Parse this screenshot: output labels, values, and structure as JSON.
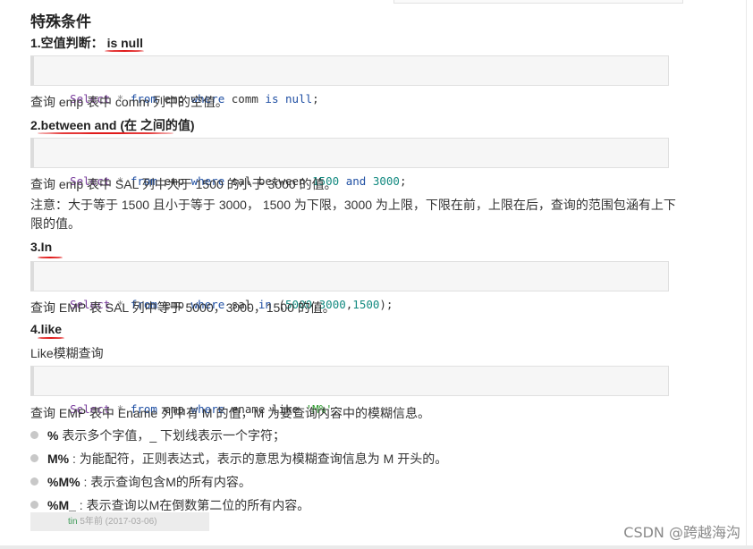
{
  "title": "特殊条件",
  "sections": [
    {
      "heading": "1.空值判断： is null",
      "code": [
        "Select",
        "*",
        "from",
        "emp",
        "where",
        "comm",
        "is",
        "null",
        ";"
      ],
      "desc": "查询 emp 表中 comm 列中的空值。"
    },
    {
      "heading": "2.between and (在 之间的值)",
      "code": [
        "Select",
        "*",
        "from",
        "emp",
        "where",
        "sal",
        "between",
        "1500",
        "and",
        "3000",
        ";"
      ],
      "desc": "查询 emp 表中 SAL 列中大于 1500 的小于 3000 的值。",
      "note": "注意：大于等于 1500 且小于等于 3000， 1500 为下限，3000 为上限，下限在前，上限在后，查询的范围包涵有上下限的值。"
    },
    {
      "heading": "3.In",
      "code": [
        "Select",
        "*",
        "from",
        "emp",
        "where",
        "sal",
        "in",
        "(",
        "5000",
        ",",
        "3000",
        ",",
        "1500",
        ");"
      ],
      "desc": "查询 EMP 表 SAL 列中等于 5000，3000，1500 的值。"
    },
    {
      "heading": "4.like",
      "subtitle": "Like模糊查询",
      "code": [
        "Select",
        "*",
        "from",
        "emp",
        "where",
        "ename",
        "like",
        "'M%'",
        ";"
      ],
      "desc": "查询 EMP 表中 Ename 列中有 M 的值，M 为要查询内容中的模糊信息。"
    }
  ],
  "bullets": [
    {
      "key": "%",
      "text": " 表示多个字值，_ 下划线表示一个字符；"
    },
    {
      "key": "M%",
      "text": " : 为能配符，正则表达式，表示的意思为模糊查询信息为 M 开头的。"
    },
    {
      "key": "%M%",
      "text": " : 表示查询包含M的所有内容。"
    },
    {
      "key": "%M_",
      "text": " : 表示查询以M在倒数第二位的所有内容。"
    }
  ],
  "comment": {
    "author": "tin",
    "time": "5年前 (2017-03-06)"
  },
  "watermark": "CSDN @跨越海沟",
  "colors": {
    "keyword": "#7a3e9d",
    "keyword2": "#1f4fa3",
    "number": "#138a80",
    "string": "#2c9a2c",
    "underline": "#e01b1b"
  }
}
